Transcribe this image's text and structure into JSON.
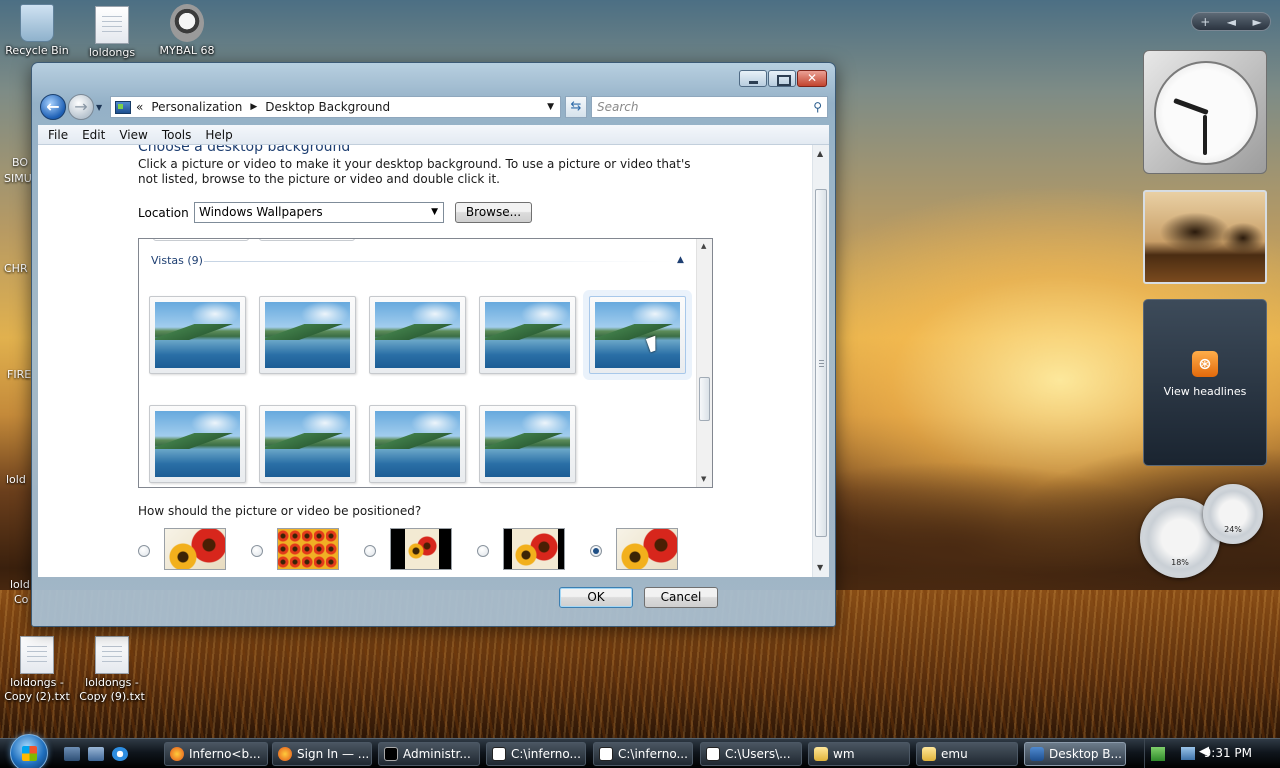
{
  "desktop": {
    "icons": [
      {
        "label": "Recycle Bin",
        "type": "bin"
      },
      {
        "label": "loldongs",
        "type": "doc"
      },
      {
        "label": "MYBAL 68",
        "type": "app"
      },
      {
        "label": "loldongs - Copy (2).txt",
        "type": "doc"
      },
      {
        "label": "loldongs - Copy (9).txt",
        "type": "doc"
      }
    ],
    "cut_labels": [
      "BO",
      "SIMU",
      "CHR",
      "FIRE",
      "lold",
      "lold",
      "Co"
    ]
  },
  "window": {
    "address": {
      "prefix": "«",
      "crumbs": [
        "Personalization",
        "Desktop Background"
      ]
    },
    "search_placeholder": "Search",
    "menu": [
      "File",
      "Edit",
      "View",
      "Tools",
      "Help"
    ],
    "content": {
      "heading_partial": "Choose a desktop background",
      "instructions": "Click a picture or video to make it your desktop background. To use a picture or video that's not listed, browse to the picture or video and double click it.",
      "location_label": "Location",
      "location_value": "Windows Wallpapers",
      "browse_label": "Browse...",
      "group_label": "Vistas (9)",
      "wallpapers": [
        {
          "name": "vista-1",
          "selected": false
        },
        {
          "name": "vista-2",
          "selected": false
        },
        {
          "name": "vista-3",
          "selected": false
        },
        {
          "name": "vista-4",
          "selected": false
        },
        {
          "name": "vista-5",
          "selected": true
        },
        {
          "name": "vista-6",
          "selected": false
        },
        {
          "name": "vista-7",
          "selected": false
        },
        {
          "name": "vista-8",
          "selected": false
        },
        {
          "name": "vista-9",
          "selected": false
        }
      ],
      "position_question": "How should the picture or video be positioned?",
      "position_options": [
        {
          "name": "fit-to-screen",
          "selected": false
        },
        {
          "name": "tile",
          "selected": false
        },
        {
          "name": "center",
          "selected": false
        },
        {
          "name": "fit",
          "selected": false
        },
        {
          "name": "fill",
          "selected": true
        }
      ]
    },
    "ok_label": "OK",
    "cancel_label": "Cancel"
  },
  "sidebar": {
    "controls": [
      "+",
      "◄",
      "►"
    ],
    "feed_label": "View headlines",
    "cpu_percent": "18%",
    "memory_percent": "24%"
  },
  "taskbar": {
    "tasks": [
      {
        "label": "Inferno<b...",
        "icon": "firefox",
        "active": false
      },
      {
        "label": "Sign In — ...",
        "icon": "firefox",
        "active": false
      },
      {
        "label": "Administr...",
        "icon": "cmd",
        "active": false
      },
      {
        "label": "C:\\inferno...",
        "icon": "7zip",
        "active": false
      },
      {
        "label": "C:\\inferno...",
        "icon": "7zip",
        "active": false
      },
      {
        "label": "C:\\Users\\...",
        "icon": "7zip",
        "active": false
      },
      {
        "label": "wm",
        "icon": "folder",
        "active": false
      },
      {
        "label": "emu",
        "icon": "folder",
        "active": false
      },
      {
        "label": "Desktop B...",
        "icon": "control-panel",
        "active": true
      }
    ],
    "clock": "9:31 PM"
  },
  "colors": {
    "accent": "#1e3f72",
    "selection": "#eaf2fb",
    "taskbar": "#10161d"
  }
}
